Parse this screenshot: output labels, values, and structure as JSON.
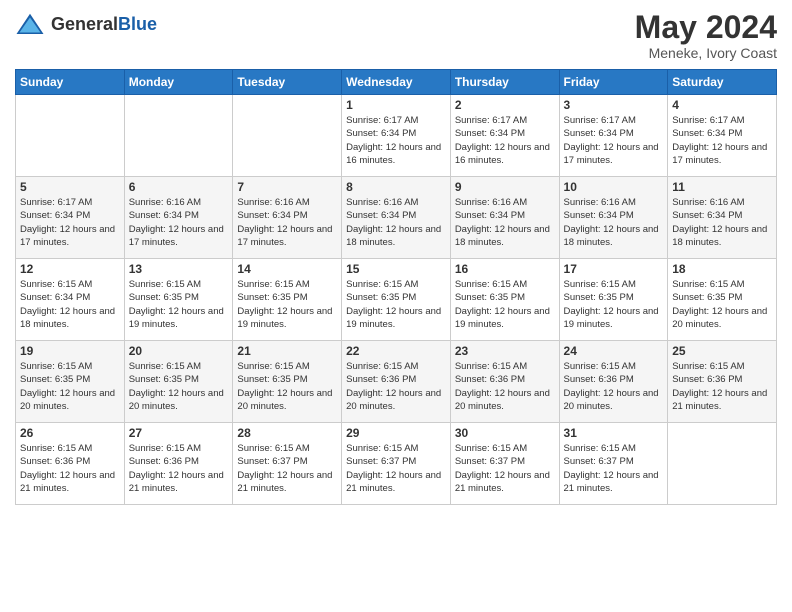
{
  "header": {
    "logo_general": "General",
    "logo_blue": "Blue",
    "title": "May 2024",
    "location": "Meneke, Ivory Coast"
  },
  "days_of_week": [
    "Sunday",
    "Monday",
    "Tuesday",
    "Wednesday",
    "Thursday",
    "Friday",
    "Saturday"
  ],
  "weeks": [
    [
      {
        "day": "",
        "info": ""
      },
      {
        "day": "",
        "info": ""
      },
      {
        "day": "",
        "info": ""
      },
      {
        "day": "1",
        "info": "Sunrise: 6:17 AM\nSunset: 6:34 PM\nDaylight: 12 hours\nand 16 minutes."
      },
      {
        "day": "2",
        "info": "Sunrise: 6:17 AM\nSunset: 6:34 PM\nDaylight: 12 hours\nand 16 minutes."
      },
      {
        "day": "3",
        "info": "Sunrise: 6:17 AM\nSunset: 6:34 PM\nDaylight: 12 hours\nand 17 minutes."
      },
      {
        "day": "4",
        "info": "Sunrise: 6:17 AM\nSunset: 6:34 PM\nDaylight: 12 hours\nand 17 minutes."
      }
    ],
    [
      {
        "day": "5",
        "info": "Sunrise: 6:17 AM\nSunset: 6:34 PM\nDaylight: 12 hours\nand 17 minutes."
      },
      {
        "day": "6",
        "info": "Sunrise: 6:16 AM\nSunset: 6:34 PM\nDaylight: 12 hours\nand 17 minutes."
      },
      {
        "day": "7",
        "info": "Sunrise: 6:16 AM\nSunset: 6:34 PM\nDaylight: 12 hours\nand 17 minutes."
      },
      {
        "day": "8",
        "info": "Sunrise: 6:16 AM\nSunset: 6:34 PM\nDaylight: 12 hours\nand 18 minutes."
      },
      {
        "day": "9",
        "info": "Sunrise: 6:16 AM\nSunset: 6:34 PM\nDaylight: 12 hours\nand 18 minutes."
      },
      {
        "day": "10",
        "info": "Sunrise: 6:16 AM\nSunset: 6:34 PM\nDaylight: 12 hours\nand 18 minutes."
      },
      {
        "day": "11",
        "info": "Sunrise: 6:16 AM\nSunset: 6:34 PM\nDaylight: 12 hours\nand 18 minutes."
      }
    ],
    [
      {
        "day": "12",
        "info": "Sunrise: 6:15 AM\nSunset: 6:34 PM\nDaylight: 12 hours\nand 18 minutes."
      },
      {
        "day": "13",
        "info": "Sunrise: 6:15 AM\nSunset: 6:35 PM\nDaylight: 12 hours\nand 19 minutes."
      },
      {
        "day": "14",
        "info": "Sunrise: 6:15 AM\nSunset: 6:35 PM\nDaylight: 12 hours\nand 19 minutes."
      },
      {
        "day": "15",
        "info": "Sunrise: 6:15 AM\nSunset: 6:35 PM\nDaylight: 12 hours\nand 19 minutes."
      },
      {
        "day": "16",
        "info": "Sunrise: 6:15 AM\nSunset: 6:35 PM\nDaylight: 12 hours\nand 19 minutes."
      },
      {
        "day": "17",
        "info": "Sunrise: 6:15 AM\nSunset: 6:35 PM\nDaylight: 12 hours\nand 19 minutes."
      },
      {
        "day": "18",
        "info": "Sunrise: 6:15 AM\nSunset: 6:35 PM\nDaylight: 12 hours\nand 20 minutes."
      }
    ],
    [
      {
        "day": "19",
        "info": "Sunrise: 6:15 AM\nSunset: 6:35 PM\nDaylight: 12 hours\nand 20 minutes."
      },
      {
        "day": "20",
        "info": "Sunrise: 6:15 AM\nSunset: 6:35 PM\nDaylight: 12 hours\nand 20 minutes."
      },
      {
        "day": "21",
        "info": "Sunrise: 6:15 AM\nSunset: 6:35 PM\nDaylight: 12 hours\nand 20 minutes."
      },
      {
        "day": "22",
        "info": "Sunrise: 6:15 AM\nSunset: 6:36 PM\nDaylight: 12 hours\nand 20 minutes."
      },
      {
        "day": "23",
        "info": "Sunrise: 6:15 AM\nSunset: 6:36 PM\nDaylight: 12 hours\nand 20 minutes."
      },
      {
        "day": "24",
        "info": "Sunrise: 6:15 AM\nSunset: 6:36 PM\nDaylight: 12 hours\nand 20 minutes."
      },
      {
        "day": "25",
        "info": "Sunrise: 6:15 AM\nSunset: 6:36 PM\nDaylight: 12 hours\nand 21 minutes."
      }
    ],
    [
      {
        "day": "26",
        "info": "Sunrise: 6:15 AM\nSunset: 6:36 PM\nDaylight: 12 hours\nand 21 minutes."
      },
      {
        "day": "27",
        "info": "Sunrise: 6:15 AM\nSunset: 6:36 PM\nDaylight: 12 hours\nand 21 minutes."
      },
      {
        "day": "28",
        "info": "Sunrise: 6:15 AM\nSunset: 6:37 PM\nDaylight: 12 hours\nand 21 minutes."
      },
      {
        "day": "29",
        "info": "Sunrise: 6:15 AM\nSunset: 6:37 PM\nDaylight: 12 hours\nand 21 minutes."
      },
      {
        "day": "30",
        "info": "Sunrise: 6:15 AM\nSunset: 6:37 PM\nDaylight: 12 hours\nand 21 minutes."
      },
      {
        "day": "31",
        "info": "Sunrise: 6:15 AM\nSunset: 6:37 PM\nDaylight: 12 hours\nand 21 minutes."
      },
      {
        "day": "",
        "info": ""
      }
    ]
  ]
}
